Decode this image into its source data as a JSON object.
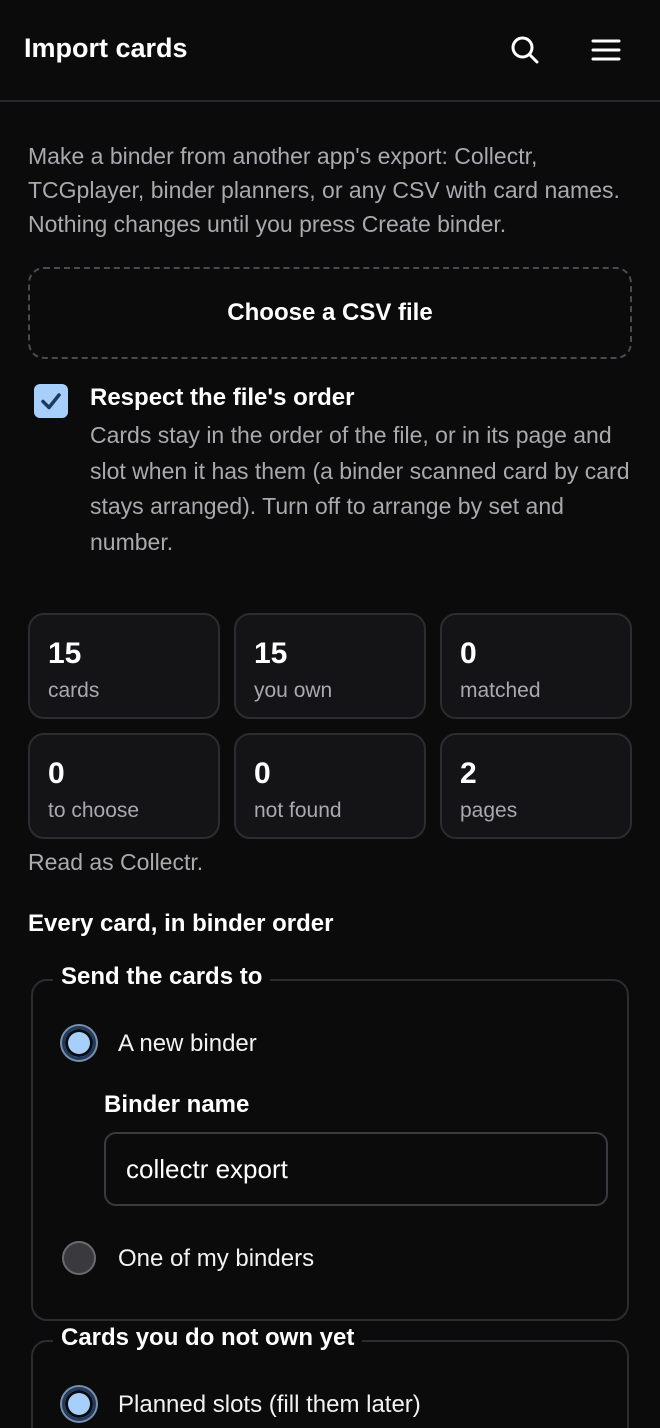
{
  "header": {
    "title": "Import cards",
    "icons": [
      "search-icon",
      "menu-icon"
    ]
  },
  "intro": "Make a binder from another app's export: Collectr, TCGplayer, binder planners, or any CSV with card names. Nothing changes until you press Create binder.",
  "file_button": "Choose a CSV file",
  "respect_order": {
    "checked": true,
    "title": "Respect the file's order",
    "description": "Cards stay in the order of the file, or in its page and slot when it has them (a binder scanned card by card stays arranged). Turn off to arrange by set and number."
  },
  "stats": [
    {
      "value": "15",
      "label": "cards"
    },
    {
      "value": "15",
      "label": "you own"
    },
    {
      "value": "0",
      "label": "matched"
    },
    {
      "value": "0",
      "label": "to choose"
    },
    {
      "value": "0",
      "label": "not found"
    },
    {
      "value": "2",
      "label": "pages"
    }
  ],
  "read_as": "Read as Collectr.",
  "section_title": "Every card, in binder order",
  "send_to": {
    "legend": "Send the cards to",
    "options": [
      {
        "label": "A new binder",
        "selected": true
      },
      {
        "label": "One of my binders",
        "selected": false
      }
    ],
    "binder_name_label": "Binder name",
    "binder_name_value": "collectr export"
  },
  "not_owned": {
    "legend": "Cards you do not own yet",
    "options": [
      {
        "label": "Planned slots (fill them later)",
        "selected": true
      }
    ]
  },
  "colors": {
    "background": "#0b0b0c",
    "accent": "#a7cffb",
    "muted_text": "#a9a9ae"
  }
}
